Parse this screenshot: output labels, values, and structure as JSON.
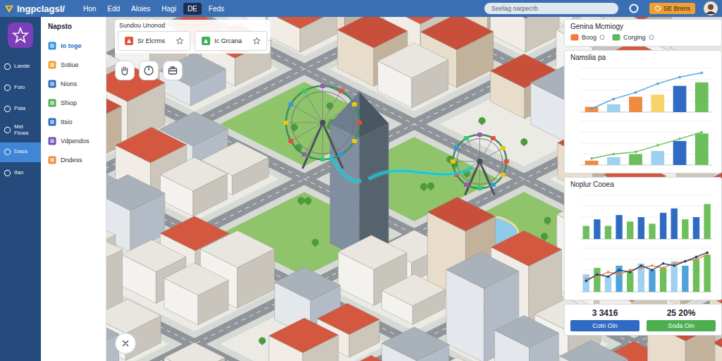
{
  "app": {
    "title": "Ingpclagsl/"
  },
  "menu": [
    {
      "label": "Hon",
      "selected": false
    },
    {
      "label": "Edd",
      "selected": false
    },
    {
      "label": "Aloies",
      "selected": false
    },
    {
      "label": "Hagi",
      "selected": false
    },
    {
      "label": "DE",
      "selected": true
    },
    {
      "label": "Feds",
      "selected": false
    }
  ],
  "search": {
    "placeholder": "Seelag narpecrb"
  },
  "account_button": "SE Brens",
  "rail": [
    {
      "label": "Lande",
      "selected": false
    },
    {
      "label": "Fsio",
      "selected": false
    },
    {
      "label": "Pala",
      "selected": false
    },
    {
      "label": "Mel Flcws",
      "selected": false
    },
    {
      "label": "Dasa",
      "selected": true
    },
    {
      "label": "Ifan",
      "selected": false
    }
  ],
  "nav": {
    "title": "Napsto",
    "items": [
      {
        "label": "Io toge",
        "selected": true,
        "color": "#2d8fe0"
      },
      {
        "label": "Sotiue",
        "selected": false,
        "color": "#f0a030"
      },
      {
        "label": "Nions",
        "selected": false,
        "color": "#2f6bc2"
      },
      {
        "label": "Shiop",
        "selected": false,
        "color": "#4caf50"
      },
      {
        "label": "Itsio",
        "selected": false,
        "color": "#2f6bc2"
      },
      {
        "label": "Vdpendos",
        "selected": false,
        "color": "#6a4fb3"
      },
      {
        "label": "Dndess",
        "selected": false,
        "color": "#f08a3c"
      }
    ]
  },
  "map": {
    "label": "Sundou Unonod",
    "cards": [
      {
        "label": "Sr Elcrms",
        "color": "#e2553f"
      },
      {
        "label": "Ic Grcana",
        "color": "#3fae5a"
      }
    ]
  },
  "summary": {
    "title": "Genina Mcmiogy",
    "chips": [
      {
        "label": "Boog",
        "color": "#f07b3a"
      },
      {
        "label": "Corging",
        "color": "#5cb85c"
      }
    ]
  },
  "charts": [
    {
      "title": "Namslia pa",
      "plots": [
        {
          "bars": [
            12,
            18,
            35,
            40,
            60,
            68
          ],
          "colors": [
            "#f08a3c",
            "#9fd0f0",
            "#f08a3c",
            "#f6d36b",
            "#2f6bc2",
            "#6cbf5a"
          ],
          "lines": [
            {
              "values": [
                8,
                30,
                45,
                65,
                80,
                90
              ],
              "color": "#4fa3d8"
            }
          ]
        },
        {
          "bars": [
            10,
            18,
            25,
            32,
            55,
            72
          ],
          "colors": [
            "#f08a3c",
            "#9fd0f0",
            "#6cbf5a",
            "#9fd0f0",
            "#2f6bc2",
            "#6cbf5a"
          ],
          "lines": [
            {
              "values": [
                15,
                25,
                30,
                45,
                60,
                75
              ],
              "color": "#6cbf5a"
            }
          ]
        }
      ]
    },
    {
      "title": "Noplur Cooea",
      "plots": [
        {
          "bars": [
            30,
            45,
            30,
            55,
            40,
            50,
            35,
            60,
            70,
            45,
            50,
            80
          ],
          "colors": [
            "#6cbf5a",
            "#2f6bc2",
            "#6cbf5a",
            "#2f6bc2",
            "#6cbf5a",
            "#2f6bc2",
            "#6cbf5a",
            "#2f6bc2",
            "#2f6bc2",
            "#6cbf5a",
            "#2f6bc2",
            "#6cbf5a"
          ],
          "lines": []
        },
        {
          "bars": [
            40,
            55,
            35,
            60,
            45,
            65,
            50,
            55,
            70,
            60,
            75,
            85
          ],
          "colors": [
            "#9fd0f0",
            "#6cbf5a",
            "#9fd0f0",
            "#4fa3d8",
            "#6cbf5a",
            "#9fd0f0",
            "#4fa3d8",
            "#6cbf5a",
            "#9fd0f0",
            "#4fa3d8",
            "#6cbf5a",
            "#6cbf5a"
          ],
          "lines": [
            {
              "values": [
                30,
                35,
                45,
                40,
                50,
                55,
                60,
                55,
                65,
                70,
                75,
                85
              ],
              "color": "#f08a3c"
            },
            {
              "values": [
                25,
                40,
                35,
                50,
                45,
                60,
                50,
                65,
                60,
                70,
                80,
                90
              ],
              "color": "#1f3f7a"
            }
          ]
        }
      ]
    }
  ],
  "stats": [
    {
      "value": "3 3416",
      "button": "Cotn Oin",
      "color": "#2f6bc2"
    },
    {
      "value": "25 20%",
      "button": "Soda Oin",
      "color": "#4caf50"
    }
  ]
}
